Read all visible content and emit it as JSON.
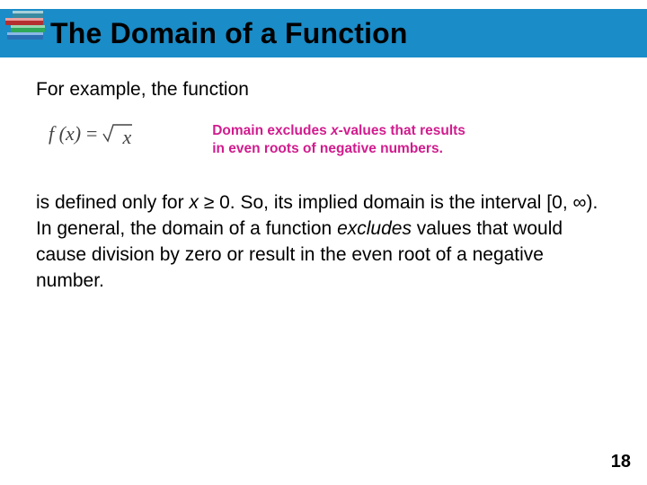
{
  "slide": {
    "title": "The Domain of a Function",
    "lead": "For example, the function",
    "equation": {
      "fx": "f (x)",
      "eq": "=",
      "radicand": "x"
    },
    "callout_line1_prefix": "Domain excludes ",
    "callout_x": "x",
    "callout_line1_suffix": "-values that results",
    "callout_line2": "in even roots of negative numbers.",
    "body_1": "is defined only for ",
    "body_x": "x",
    "body_geq": " ≥ 0. So, its implied domain is the interval [0, ∞). In general, the domain of a function ",
    "body_excludes": "excludes",
    "body_tail": " values that would cause division by zero or result in the even root of a negative number.",
    "page_number": "18"
  }
}
